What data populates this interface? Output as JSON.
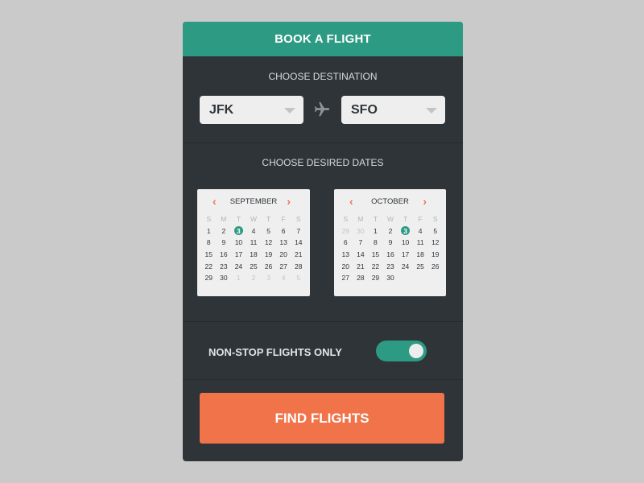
{
  "header": {
    "title": "BOOK A FLIGHT"
  },
  "destination": {
    "label": "CHOOSE DESTINATION",
    "from": "JFK",
    "to": "SFO"
  },
  "dates": {
    "label": "CHOOSE DESIRED DATES",
    "calendars": [
      {
        "month": "SEPTEMBER",
        "weekdays": [
          "S",
          "M",
          "T",
          "W",
          "T",
          "F",
          "S"
        ],
        "days": [
          {
            "d": "1"
          },
          {
            "d": "2"
          },
          {
            "d": "3",
            "selected": true
          },
          {
            "d": "4"
          },
          {
            "d": "5"
          },
          {
            "d": "6"
          },
          {
            "d": "7"
          },
          {
            "d": "8"
          },
          {
            "d": "9"
          },
          {
            "d": "10"
          },
          {
            "d": "11"
          },
          {
            "d": "12"
          },
          {
            "d": "13"
          },
          {
            "d": "14"
          },
          {
            "d": "15"
          },
          {
            "d": "16"
          },
          {
            "d": "17"
          },
          {
            "d": "18"
          },
          {
            "d": "19"
          },
          {
            "d": "20"
          },
          {
            "d": "21"
          },
          {
            "d": "22"
          },
          {
            "d": "23"
          },
          {
            "d": "24"
          },
          {
            "d": "25"
          },
          {
            "d": "26"
          },
          {
            "d": "27"
          },
          {
            "d": "28"
          },
          {
            "d": "29"
          },
          {
            "d": "30"
          },
          {
            "d": "1",
            "muted": true
          },
          {
            "d": "2",
            "muted": true
          },
          {
            "d": "3",
            "muted": true
          },
          {
            "d": "4",
            "muted": true
          },
          {
            "d": "5",
            "muted": true
          }
        ]
      },
      {
        "month": "OCTOBER",
        "weekdays": [
          "S",
          "M",
          "T",
          "W",
          "T",
          "F",
          "S"
        ],
        "days": [
          {
            "d": "29",
            "muted": true
          },
          {
            "d": "30",
            "muted": true
          },
          {
            "d": "1"
          },
          {
            "d": "2"
          },
          {
            "d": "3",
            "selected": true
          },
          {
            "d": "4"
          },
          {
            "d": "5"
          },
          {
            "d": "6"
          },
          {
            "d": "7"
          },
          {
            "d": "8"
          },
          {
            "d": "9"
          },
          {
            "d": "10"
          },
          {
            "d": "11"
          },
          {
            "d": "12"
          },
          {
            "d": "13"
          },
          {
            "d": "14"
          },
          {
            "d": "15"
          },
          {
            "d": "16"
          },
          {
            "d": "17"
          },
          {
            "d": "18"
          },
          {
            "d": "19"
          },
          {
            "d": "20"
          },
          {
            "d": "21"
          },
          {
            "d": "22"
          },
          {
            "d": "23"
          },
          {
            "d": "24"
          },
          {
            "d": "25"
          },
          {
            "d": "26"
          },
          {
            "d": "27"
          },
          {
            "d": "28"
          },
          {
            "d": "29"
          },
          {
            "d": "30"
          }
        ]
      }
    ]
  },
  "options": {
    "nonstop_label": "NON-STOP FLIGHTS ONLY",
    "nonstop_enabled": true
  },
  "actions": {
    "find_label": "FIND FLIGHTS"
  },
  "colors": {
    "accent": "#2d9a83",
    "cta": "#f0734a",
    "panel": "#2f3438",
    "background": "#c9cac9"
  },
  "icons": {
    "plane": "airplane-icon",
    "prev": "chevron-left-icon",
    "next": "chevron-right-icon",
    "dropdown": "caret-down-icon"
  }
}
